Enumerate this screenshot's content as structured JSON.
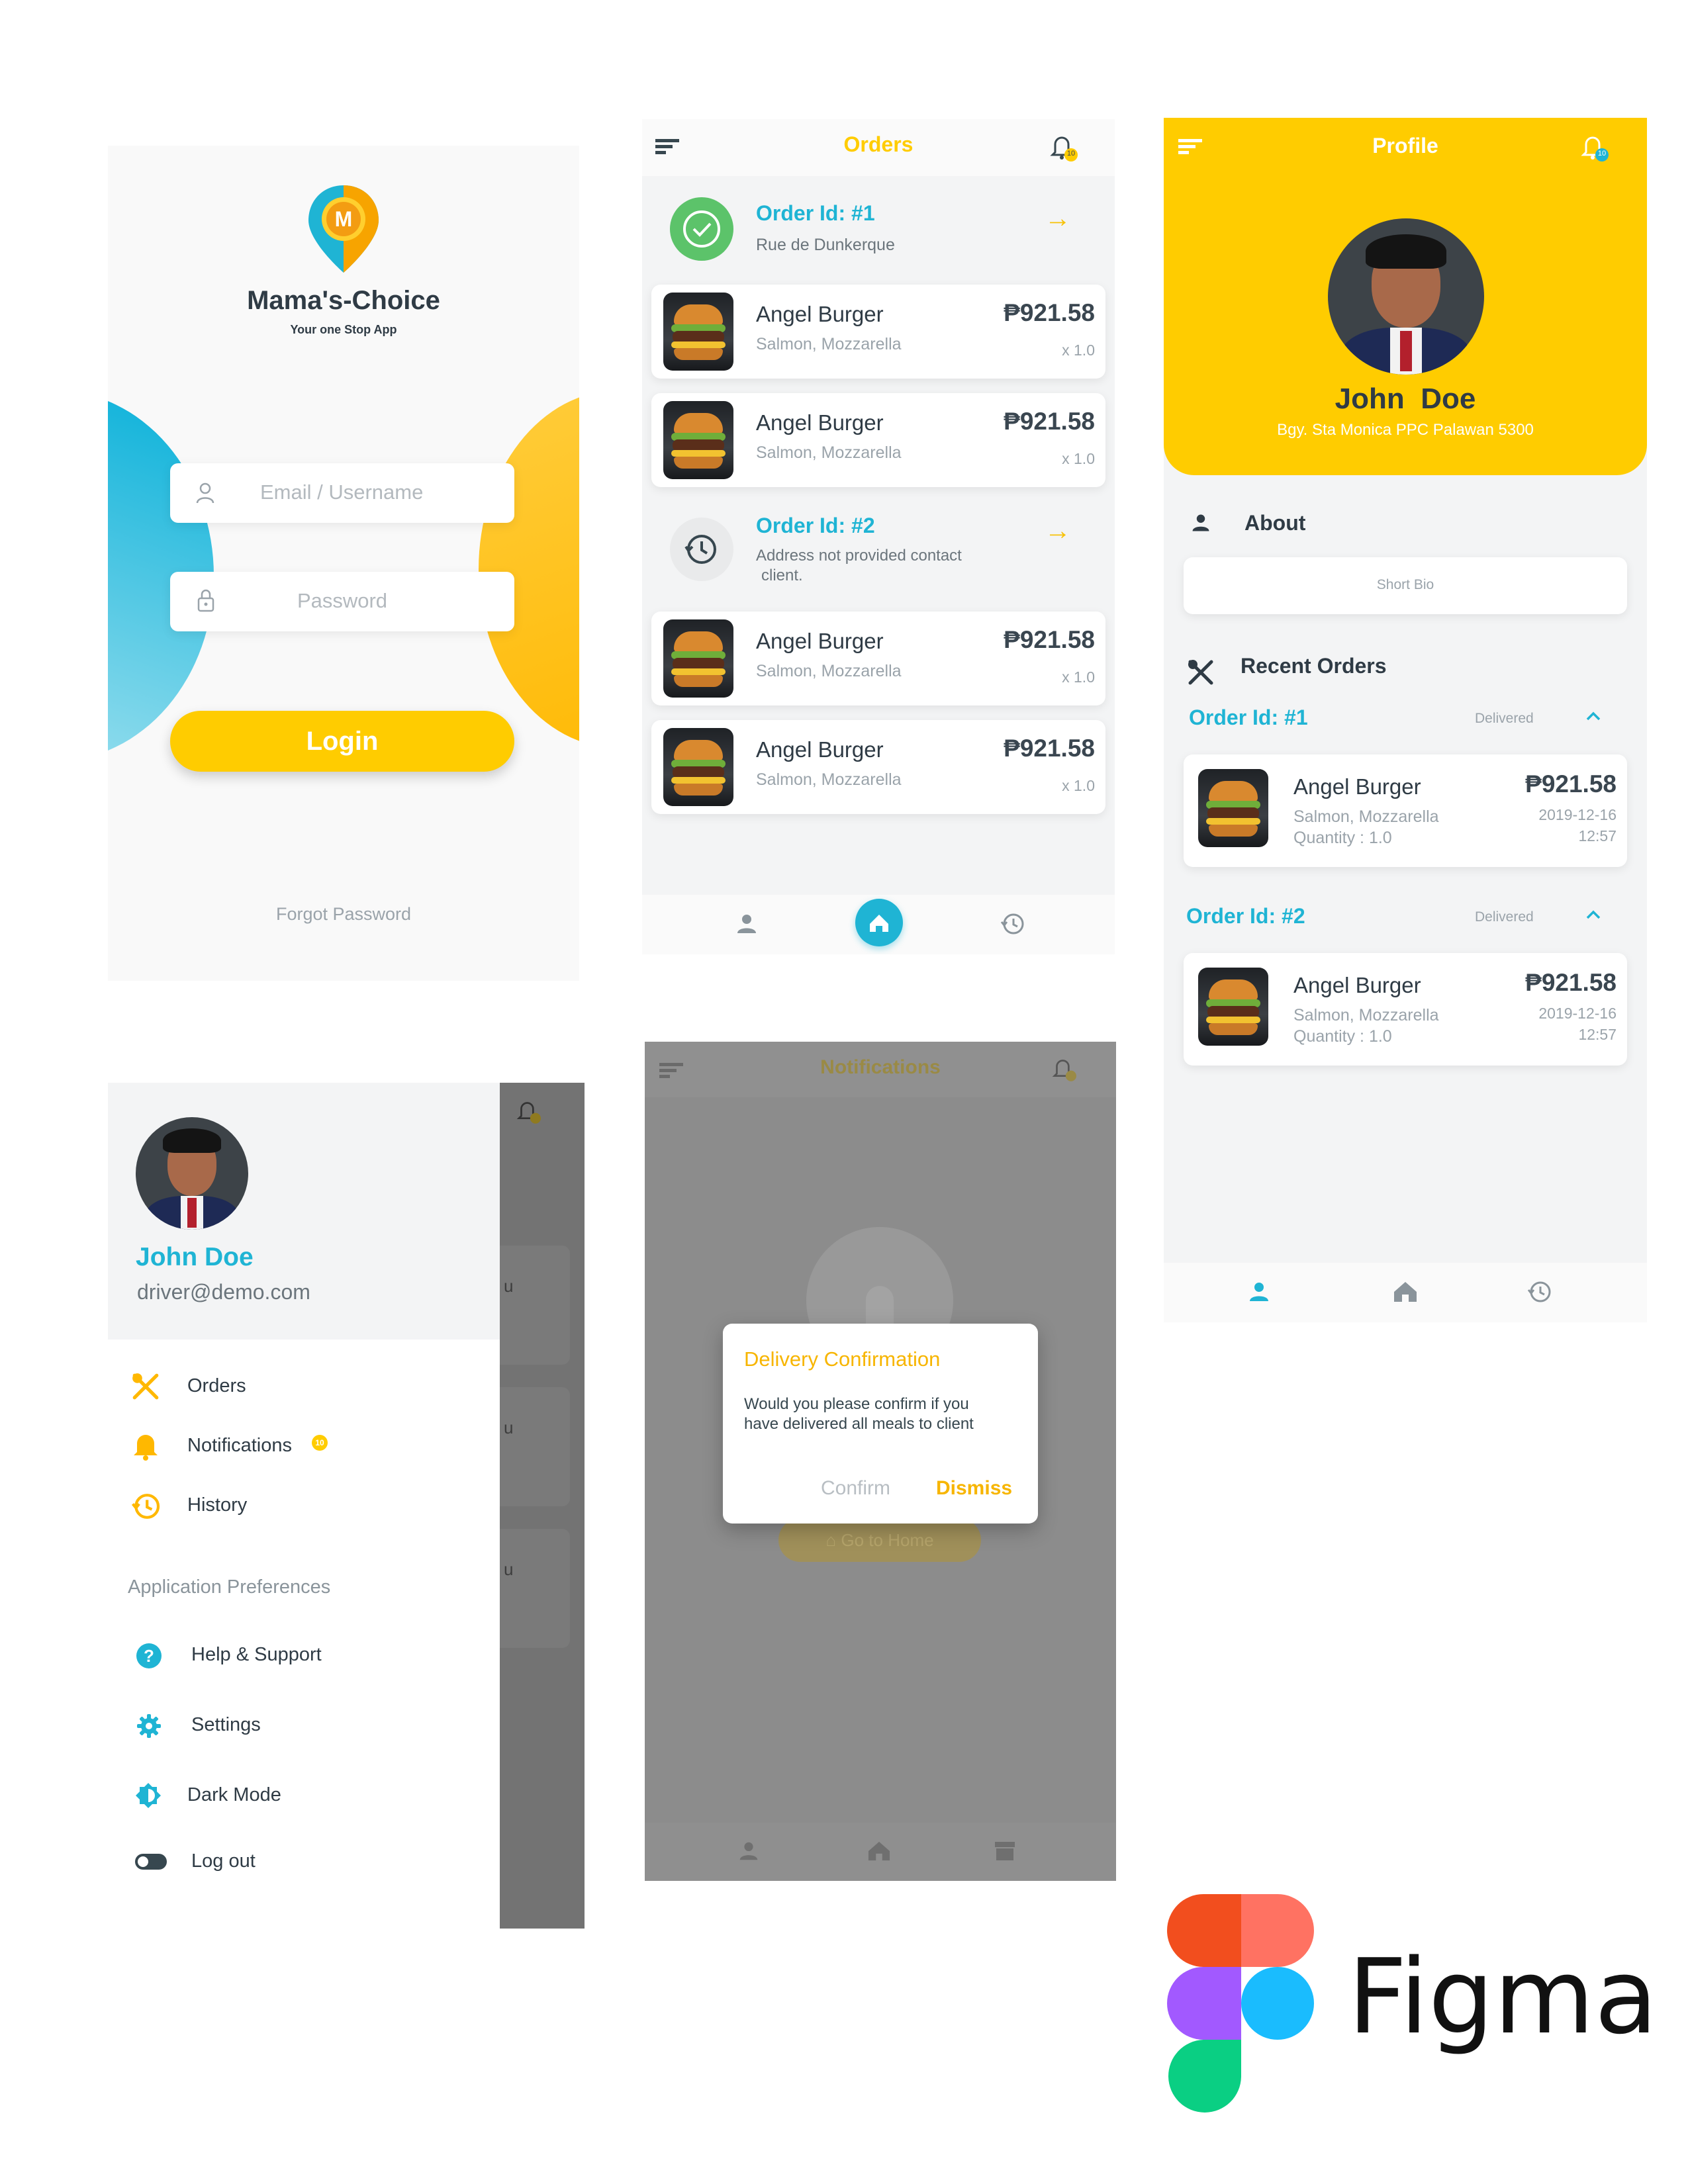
{
  "login": {
    "app_name": "Mama's-Choice",
    "tagline": "Your one Stop App",
    "logo_letter": "M",
    "email_placeholder": "Email / Username",
    "password_placeholder": "Password",
    "login_button": "Login",
    "forgot_password": "Forgot Password"
  },
  "orders": {
    "title": "Orders",
    "orders": [
      {
        "id_label": "Order Id: #1",
        "address": "Rue de Dunkerque",
        "status_icon": "check-circle-icon",
        "items": [
          {
            "name": "Angel Burger",
            "desc": "Salmon, Mozzarella",
            "price": "₱921.58",
            "qty": "x 1.0"
          },
          {
            "name": "Angel Burger",
            "desc": "Salmon, Mozzarella",
            "price": "₱921.58",
            "qty": "x 1.0"
          }
        ]
      },
      {
        "id_label": "Order Id: #2",
        "address_line1": "Address not provided contact",
        "address_line2": "client.",
        "status_icon": "history-icon",
        "items": [
          {
            "name": "Angel Burger",
            "desc": "Salmon, Mozzarella",
            "price": "₱921.58",
            "qty": "x 1.0"
          },
          {
            "name": "Angel Burger",
            "desc": "Salmon, Mozzarella",
            "price": "₱921.58",
            "qty": "x 1.0"
          }
        ]
      }
    ],
    "notification_count": "10"
  },
  "profile": {
    "title": "Profile",
    "first_name": "John",
    "last_name": "Doe",
    "address": "Bgy. Sta Monica PPC Palawan 5300",
    "notification_count": "10",
    "about_label": "About",
    "bio_placeholder": "Short Bio",
    "recent_orders_label": "Recent Orders",
    "recent_orders": [
      {
        "id_label": "Order Id: #1",
        "status": "Delivered",
        "name": "Angel Burger",
        "desc": "Salmon, Mozzarella",
        "qty": "Quantity :  1.0",
        "price": "₱921.58",
        "date": "2019-12-16",
        "time": "12:57"
      },
      {
        "id_label": "Order Id: #2",
        "status": "Delivered",
        "name": "Angel Burger",
        "desc": "Salmon, Mozzarella",
        "qty": "Quantity :  1.0",
        "price": "₱921.58",
        "date": "2019-12-16",
        "time": "12:57"
      }
    ]
  },
  "drawer": {
    "name": "John Doe",
    "email": "driver@demo.com",
    "items": [
      {
        "label": "Orders",
        "icon": "utensils-icon"
      },
      {
        "label": "Notifications",
        "icon": "bell-icon",
        "badge": "10"
      },
      {
        "label": "History",
        "icon": "history-icon"
      }
    ],
    "section_label": "Application Preferences",
    "pref_items": [
      {
        "label": "Help & Support",
        "icon": "help-icon"
      },
      {
        "label": "Settings",
        "icon": "gear-icon"
      },
      {
        "label": "Dark Mode",
        "icon": "brightness-icon"
      },
      {
        "label": "Log out",
        "icon": "toggle-icon"
      }
    ],
    "behind_fragments": [
      "u",
      "u",
      "u"
    ]
  },
  "notifications": {
    "title": "Notifications",
    "dialog_title": "Delivery Confirmation",
    "dialog_line1": "Would you please confirm if you",
    "dialog_line2": "have delivered all meals to client",
    "confirm": "Confirm",
    "dismiss": "Dismiss",
    "go_home": "Go to Home"
  },
  "figma": {
    "wordmark": "Figma"
  },
  "colors": {
    "yellow": "#ffcc00",
    "cyan": "#1fb4d4",
    "dark": "#2f3b45",
    "muted": "#9aa3aa"
  }
}
